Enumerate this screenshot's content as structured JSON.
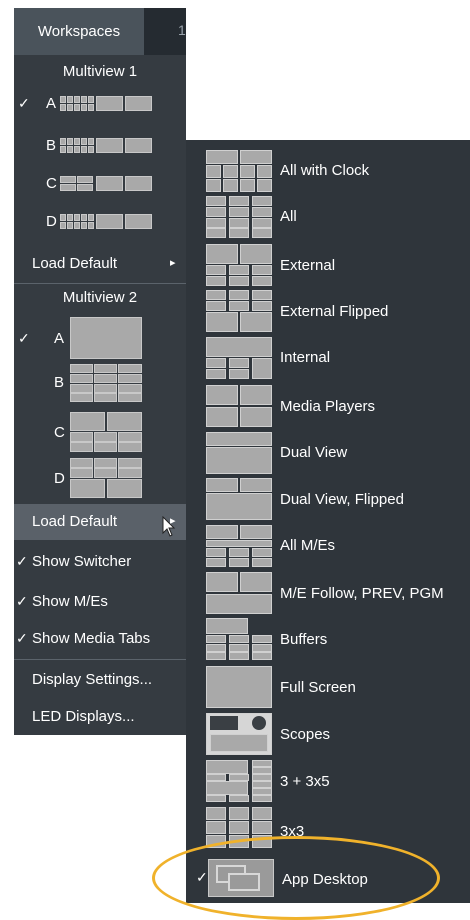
{
  "topbar": {
    "workspaces_label": "Workspaces",
    "next_label": "1"
  },
  "multiview1": {
    "header": "Multiview 1",
    "items": [
      {
        "letter": "A",
        "checked": true
      },
      {
        "letter": "B",
        "checked": false
      },
      {
        "letter": "C",
        "checked": false
      },
      {
        "letter": "D",
        "checked": false
      }
    ],
    "load_default": "Load Default",
    "arrow": "▸"
  },
  "multiview2": {
    "header": "Multiview 2",
    "items": [
      {
        "letter": "A",
        "checked": true
      },
      {
        "letter": "B",
        "checked": false
      },
      {
        "letter": "C",
        "checked": false
      },
      {
        "letter": "D",
        "checked": false
      }
    ],
    "load_default": "Load Default",
    "arrow": "▸"
  },
  "check_glyph": "✓",
  "options": [
    {
      "label": "Show Switcher",
      "checked": true
    },
    {
      "label": "Show M/Es",
      "checked": true
    },
    {
      "label": "Show Media Tabs",
      "checked": true
    }
  ],
  "settings": [
    {
      "label": "Display Settings..."
    },
    {
      "label": "LED Displays..."
    }
  ],
  "submenu": {
    "items": [
      {
        "label": "All with Clock",
        "icon": "layout-all-with-clock-icon"
      },
      {
        "label": "All",
        "icon": "layout-all-icon"
      },
      {
        "label": "External",
        "icon": "layout-external-icon"
      },
      {
        "label": "External Flipped",
        "icon": "layout-external-flipped-icon"
      },
      {
        "label": "Internal",
        "icon": "layout-internal-icon"
      },
      {
        "label": "Media Players",
        "icon": "layout-media-players-icon"
      },
      {
        "label": "Dual View",
        "icon": "layout-dual-view-icon"
      },
      {
        "label": "Dual View, Flipped",
        "icon": "layout-dual-view-flipped-icon"
      },
      {
        "label": "All M/Es",
        "icon": "layout-all-mes-icon"
      },
      {
        "label": "M/E Follow, PREV, PGM",
        "icon": "layout-me-follow-icon"
      },
      {
        "label": "Buffers",
        "icon": "layout-buffers-icon"
      },
      {
        "label": "Full Screen",
        "icon": "layout-full-screen-icon"
      },
      {
        "label": "Scopes",
        "icon": "layout-scopes-icon"
      },
      {
        "label": "3 + 3x5",
        "icon": "layout-3-plus-3x5-icon"
      },
      {
        "label": "3x3",
        "icon": "layout-3x3-icon"
      },
      {
        "label": "App Desktop",
        "icon": "app-desktop-icon",
        "checked": true
      }
    ]
  },
  "colors": {
    "menu_bg": "#353b41",
    "submenu_bg": "#2f353b",
    "highlight": "#5a6169",
    "oval": "#f0b22b"
  }
}
